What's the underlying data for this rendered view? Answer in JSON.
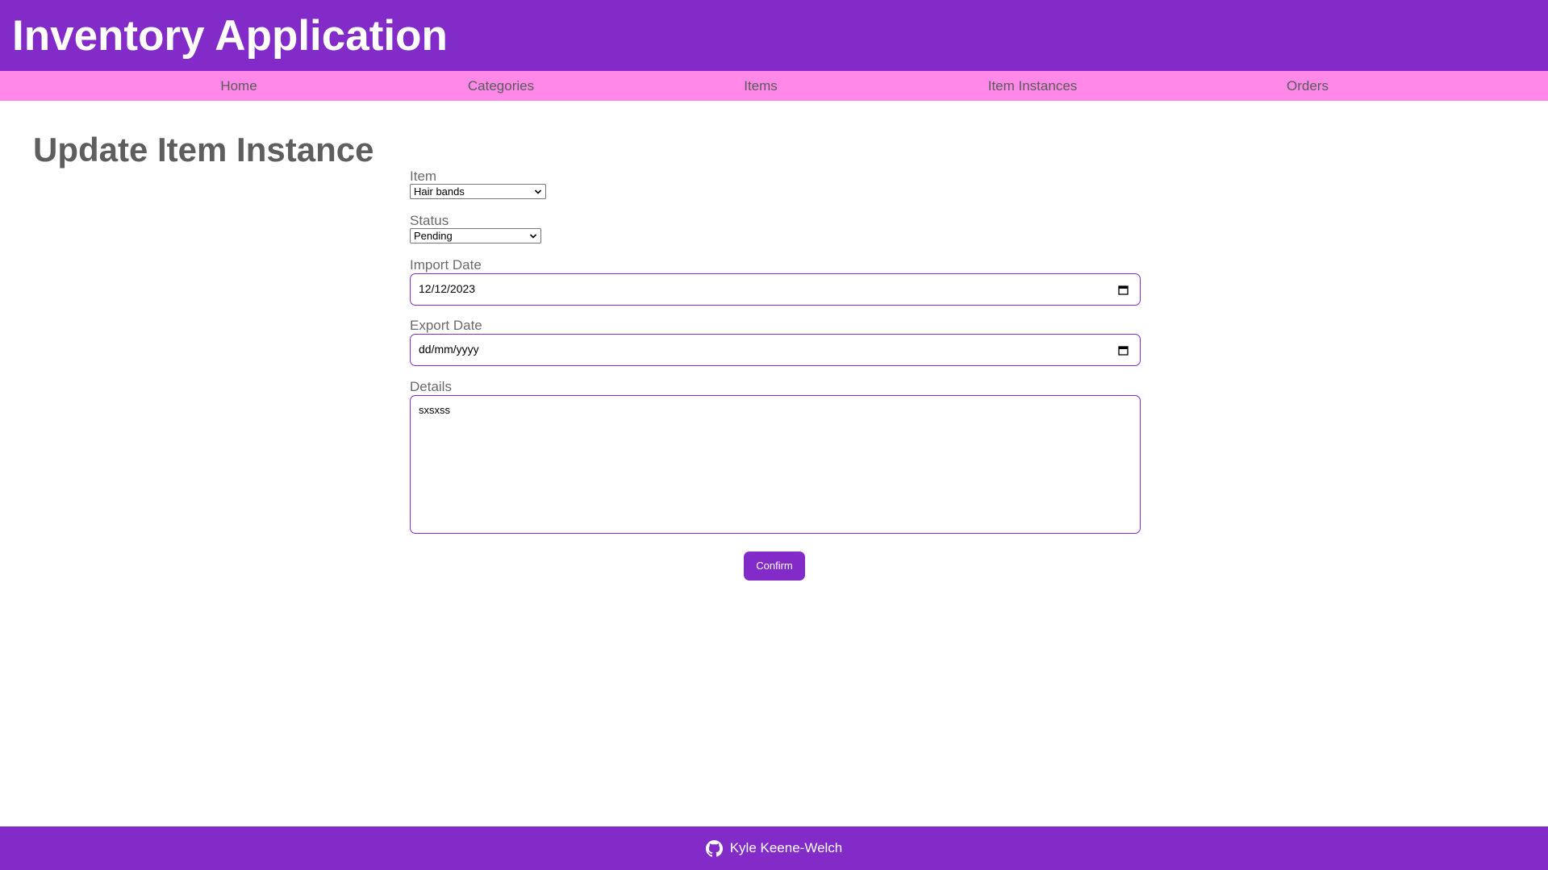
{
  "header": {
    "title": "Inventory Application"
  },
  "nav": {
    "items": [
      {
        "label": "Home"
      },
      {
        "label": "Categories"
      },
      {
        "label": "Items"
      },
      {
        "label": "Item Instances"
      },
      {
        "label": "Orders"
      }
    ]
  },
  "page": {
    "title": "Update Item Instance"
  },
  "form": {
    "item": {
      "label": "Item",
      "value": "Hair bands"
    },
    "status": {
      "label": "Status",
      "value": "Pending"
    },
    "import_date": {
      "label": "Import Date",
      "value": "12/12/2023"
    },
    "export_date": {
      "label": "Export Date",
      "placeholder": "dd/mm/yyyy"
    },
    "details": {
      "label": "Details",
      "value": "sxsxss"
    },
    "confirm_label": "Confirm"
  },
  "footer": {
    "author": "Kyle Keene-Welch",
    "icon": "github-icon"
  },
  "colors": {
    "primary": "#822bc8",
    "nav_bg": "#ff88e8",
    "text": "#5e5e5e"
  }
}
